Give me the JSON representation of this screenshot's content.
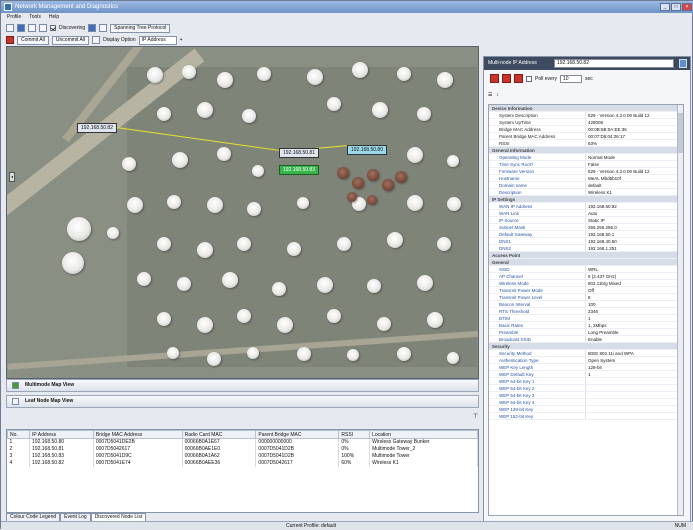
{
  "window": {
    "title": "Network Management and Diagnostics"
  },
  "menu": [
    "Profile",
    "Tools",
    "Help"
  ],
  "toolbar1": {
    "discovering": "Discovering",
    "spanning": "Spanning Tree Protocol"
  },
  "toolbar2": {
    "commit": "Commit All",
    "uncommit": "Uncommit All",
    "display_option": "Display Option",
    "display_value": "IP Address"
  },
  "map": {
    "nodes": [
      {
        "label": "192.168.50.82"
      },
      {
        "label": "192.168.50.81"
      },
      {
        "label": "192.168.50.83"
      },
      {
        "label": "192.168.50.80"
      }
    ]
  },
  "views": {
    "multimode": "Multimode Map View",
    "leaf": "Leaf Node Map View"
  },
  "grid": {
    "headers": [
      "No.",
      "IP Address",
      "Bridge MAC Address",
      "Radio Card MAC",
      "Parent Bridge MAC",
      "RSSI",
      "Location"
    ],
    "rows": [
      [
        "1",
        "192.168.50.80",
        "0007D5041DE2B",
        "00066B0A1E67",
        "000000000000",
        "0%",
        "Wireless Gateway Bunker"
      ],
      [
        "2",
        "192.168.50.81",
        "0007D5042617",
        "00066B0AE1E0",
        "0007D5041D2B",
        "0%",
        "Multimode Tower_2"
      ],
      [
        "3",
        "192.168.50.83",
        "0007D5041D9C",
        "00066B0A1A62",
        "0007D5041D2B",
        "100%",
        "Multimode Tower"
      ],
      [
        "4",
        "192.168.50.82",
        "0007D5041E74",
        "00066B0AEE36",
        "0007D5042617",
        "60%",
        "Wireless K1"
      ]
    ]
  },
  "tabs": [
    "Colour Code Legend",
    "Event Log",
    "Discovered Node List"
  ],
  "status": {
    "profile": "Current Profile: default",
    "cap": "NUM"
  },
  "right_panel": {
    "header_label": "Multi-node IP Address",
    "ip_value": "192.168.50.82",
    "poll_label": "Poll every",
    "poll_value": "10",
    "poll_unit": "sec",
    "groups": [
      {
        "title": "Device Information",
        "rows": [
          [
            "System Description",
            "529 - Version 4.3.0.00 Build 12"
          ],
          [
            "System UpTime",
            "428008"
          ],
          [
            "Bridge MAC Address",
            "00:0B:6B:0A:EE:36"
          ],
          [
            "Parent Bridge MAC Address",
            "00:07:D5:04:26:17"
          ],
          [
            "RSSI",
            "63%"
          ]
        ]
      },
      {
        "title": "General Information",
        "rows": [
          [
            "Operating Mode",
            "Normal Mode"
          ],
          [
            "Time Sync Root?",
            "False"
          ],
          [
            "Firmware Version",
            "529 - Version 4.3.0.00 Build 12"
          ],
          [
            "Hostname",
            "MeAL Mbd5b10f"
          ],
          [
            "Domain name",
            "default"
          ],
          [
            "Description",
            "Wireless K1"
          ]
        ]
      },
      {
        "title": "IP Settings",
        "rows": [
          [
            "WAN IP Address",
            "192.168.50.82"
          ],
          [
            "WAN Link",
            "Auto"
          ],
          [
            "IP Source",
            "Static IP"
          ],
          [
            "Subnet Mask",
            "255.255.255.0"
          ],
          [
            "Default Gateway",
            "192.168.50.1"
          ],
          [
            "DNS1",
            "192.168.40.50"
          ],
          [
            "DNS2",
            "192.168.1.251"
          ]
        ]
      },
      {
        "title": "Access Point",
        "rows": []
      },
      {
        "title": "General",
        "rows": [
          [
            "SSID",
            "WRL"
          ],
          [
            "AP Channel",
            "6 (2.437 GHz)"
          ],
          [
            "Wireless Mode",
            "802.11b/g Mixed"
          ],
          [
            "Transmit Power Mode",
            "Off"
          ],
          [
            "Transmit Power Level",
            "8"
          ],
          [
            "Beacon Interval",
            "100"
          ],
          [
            "RTS Threshold",
            "2346"
          ],
          [
            "DTIM",
            "1"
          ],
          [
            "Basic Rates",
            "1, 2Mbps"
          ],
          [
            "Preamble",
            "Long Preamble"
          ],
          [
            "Broadcast SSID",
            "Enable"
          ]
        ]
      },
      {
        "title": "Security",
        "rows": [
          [
            "Security Method",
            "IEEE 802.11i and WPA"
          ],
          [
            "Authentication Type",
            "Open System"
          ],
          [
            "WEP Key Length",
            "128-bit"
          ],
          [
            "WEP Default Key",
            "1"
          ],
          [
            "WEP 64-bit Key 1",
            ""
          ],
          [
            "WEP 64-bit Key 2",
            ""
          ],
          [
            "WEP 64-bit Key 3",
            ""
          ],
          [
            "WEP 64-bit Key 4",
            ""
          ],
          [
            "WEP 128-bit Key",
            ""
          ],
          [
            "WEP 152-bit Key",
            ""
          ]
        ]
      }
    ]
  }
}
